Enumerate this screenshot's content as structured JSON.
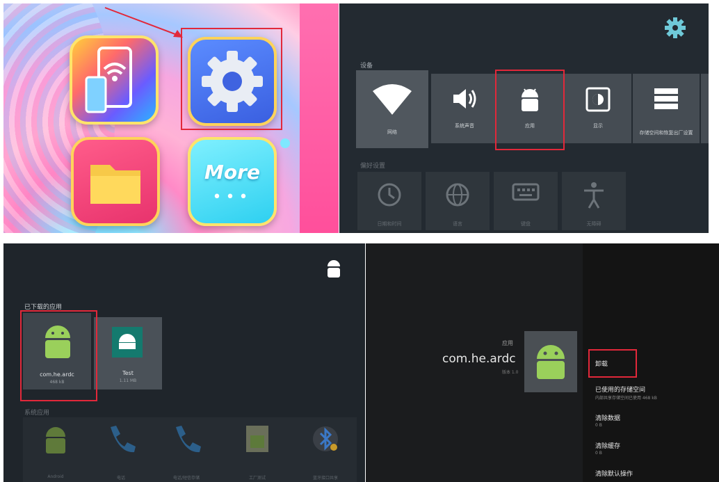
{
  "launcher": {
    "apps": [
      {
        "name": "wifi-display-app",
        "icon": "phone-wifi-icon"
      },
      {
        "name": "settings-app",
        "icon": "gear-icon"
      },
      {
        "name": "file-manager-app",
        "icon": "folder-icon"
      },
      {
        "name": "more-app",
        "label": "More",
        "dots": "•••"
      }
    ],
    "highlight_color": "#e2283a",
    "arrow_color": "#e2283a"
  },
  "settings": {
    "section_device": "设备",
    "device_items": [
      {
        "label": "网络",
        "icon": "wifi-icon"
      },
      {
        "label": "系统声音",
        "icon": "speaker-icon"
      },
      {
        "label": "应用",
        "icon": "android-icon"
      },
      {
        "label": "显示",
        "icon": "display-icon"
      },
      {
        "label": "存储空间和恢复出厂设置",
        "icon": "storage-icon"
      }
    ],
    "section_preferences": "偏好设置",
    "preference_items": [
      {
        "label": "日期和时间",
        "icon": "clock-icon"
      },
      {
        "label": "语言",
        "icon": "globe-icon"
      },
      {
        "label": "键盘",
        "icon": "keyboard-icon"
      },
      {
        "label": "无障碍",
        "icon": "accessibility-icon"
      }
    ]
  },
  "apps": {
    "section_downloaded": "已下载的应用",
    "downloaded": [
      {
        "name": "com.he.ardc",
        "size": "468 kB"
      },
      {
        "name": "Test",
        "size": "1.11 MB"
      }
    ],
    "section_system": "系统应用",
    "system": [
      {
        "label": "Android",
        "icon": "android-icon"
      },
      {
        "label": "电话",
        "icon": "phone-icon"
      },
      {
        "label": "电话/短信存储",
        "icon": "phone-storage-icon"
      },
      {
        "label": "工厂测试",
        "icon": "factory-test-icon"
      },
      {
        "label": "蓝牙接口共享",
        "icon": "bluetooth-icon"
      }
    ]
  },
  "app_info": {
    "category": "应用",
    "package": "com.he.ardc",
    "version": "版本 1.0",
    "options": [
      {
        "title": "卸载",
        "sub": ""
      },
      {
        "title": "已使用的存储空间",
        "sub": "内部共享存储空间已使用 468 kB"
      },
      {
        "title": "清除数据",
        "sub": "0 B"
      },
      {
        "title": "清除缓存",
        "sub": "0 B"
      },
      {
        "title": "清除默认操作",
        "sub": ""
      }
    ]
  }
}
